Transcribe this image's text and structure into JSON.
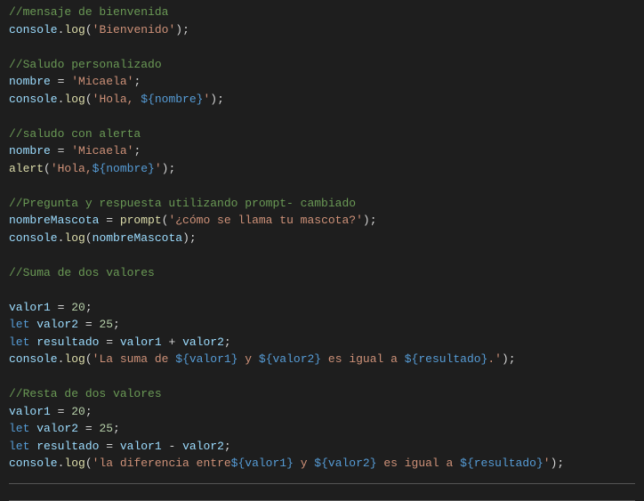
{
  "code": {
    "l1_comment": "//mensaje de bienvenida",
    "l2_obj": "console",
    "l2_dot": ".",
    "l2_method": "log",
    "l2_p1": "(",
    "l2_str": "'Bienvenido'",
    "l2_p2": ");",
    "l3_comment": "//Saludo personalizado",
    "l4_var": "nombre",
    "l4_eq": " = ",
    "l4_str": "'Micaela'",
    "l4_sc": ";",
    "l5_obj": "console",
    "l5_dot": ".",
    "l5_method": "log",
    "l5_p1": "(",
    "l5_str1": "'Hola, ",
    "l5_tmpl": "${nombre}",
    "l5_str2": "'",
    "l5_p2": ");",
    "l6_comment": "//saludo con alerta",
    "l7_var": "nombre",
    "l7_eq": " = ",
    "l7_str": "'Micaela'",
    "l7_sc": ";",
    "l8_fn": "alert",
    "l8_p1": "(",
    "l8_str1": "'Hola,",
    "l8_tmpl": "${nombre}",
    "l8_str2": "'",
    "l8_p2": ");",
    "l9_comment": "//Pregunta y respuesta utilizando prompt- cambiado",
    "l10_var": "nombreMascota",
    "l10_eq": " = ",
    "l10_fn": "prompt",
    "l10_p1": "(",
    "l10_str": "'¿cómo se llama tu mascota?'",
    "l10_p2": ");",
    "l11_obj": "console",
    "l11_dot": ".",
    "l11_method": "log",
    "l11_p1": "(",
    "l11_arg": "nombreMascota",
    "l11_p2": ");",
    "l12_comment": "//Suma de dos valores",
    "l13_var": "valor1",
    "l13_eq": " = ",
    "l13_num": "20",
    "l13_sc": ";",
    "l14_let": "let",
    "l14_sp": " ",
    "l14_var": "valor2",
    "l14_eq": " = ",
    "l14_num": "25",
    "l14_sc": ";",
    "l15_let": "let",
    "l15_sp": " ",
    "l15_var": "resultado",
    "l15_eq": " = ",
    "l15_a": "valor1",
    "l15_op": " + ",
    "l15_b": "valor2",
    "l15_sc": ";",
    "l16_obj": "console",
    "l16_dot": ".",
    "l16_method": "log",
    "l16_p1": "(",
    "l16_s1": "'La suma de ",
    "l16_t1": "${valor1}",
    "l16_s2": " y ",
    "l16_t2": "${valor2}",
    "l16_s3": " es igual a ",
    "l16_t3": "${resultado}",
    "l16_s4": ".'",
    "l16_p2": ");",
    "l17_comment": "//Resta de dos valores",
    "l18_var": "valor1",
    "l18_eq": " = ",
    "l18_num": "20",
    "l18_sc": ";",
    "l19_let": "let",
    "l19_sp": " ",
    "l19_var": "valor2",
    "l19_eq": " = ",
    "l19_num": "25",
    "l19_sc": ";",
    "l20_let": "let",
    "l20_sp": " ",
    "l20_var": "resultado",
    "l20_eq": " = ",
    "l20_a": "valor1",
    "l20_op": " - ",
    "l20_b": "valor2",
    "l20_sc": ";",
    "l21_obj": "console",
    "l21_dot": ".",
    "l21_method": "log",
    "l21_p1": "(",
    "l21_s1": "'la diferencia entre",
    "l21_t1": "${valor1}",
    "l21_s2": " y ",
    "l21_t2": "${valor2}",
    "l21_s3": " es igual a ",
    "l21_t3": "${resultado}",
    "l21_s4": "'",
    "l21_p2": ");"
  }
}
